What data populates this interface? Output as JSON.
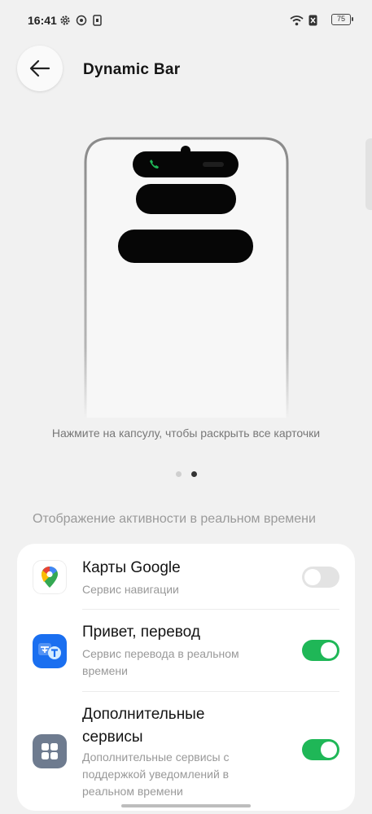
{
  "status_bar": {
    "time": "16:41",
    "battery": "75",
    "left_icons": [
      "gear-icon",
      "radio-icon",
      "sim-card-icon"
    ],
    "right_icons": [
      "wifi-icon",
      "no-sim-icon",
      "battery-icon"
    ]
  },
  "header": {
    "title": "Dynamic Bar",
    "back_icon": "arrow-left-icon"
  },
  "preview": {
    "hint": "Нажмите на капсулу, чтобы раскрыть все карточки",
    "page_count": 2,
    "active_page": 2
  },
  "section": {
    "label": "Отображение активности в реальном времени"
  },
  "apps": [
    {
      "name": "Карты Google",
      "subtitle": "Сервис навигации",
      "icon": "google-maps-icon",
      "enabled": false
    },
    {
      "name": "Привет, перевод",
      "subtitle": "Сервис перевода в реальном времени",
      "icon": "translate-icon",
      "enabled": true
    },
    {
      "name": "Дополнительные сервисы",
      "subtitle": "Дополнительные сервисы с поддержкой уведомлений в реальном времени",
      "icon": "apps-grid-icon",
      "enabled": true
    }
  ],
  "colors": {
    "background": "#f1f1f1",
    "toggle_on": "#1fb757",
    "toggle_off": "#e3e3e3",
    "translate_icon": "#1a6ff0",
    "apps_icon": "#6e7b8f"
  }
}
